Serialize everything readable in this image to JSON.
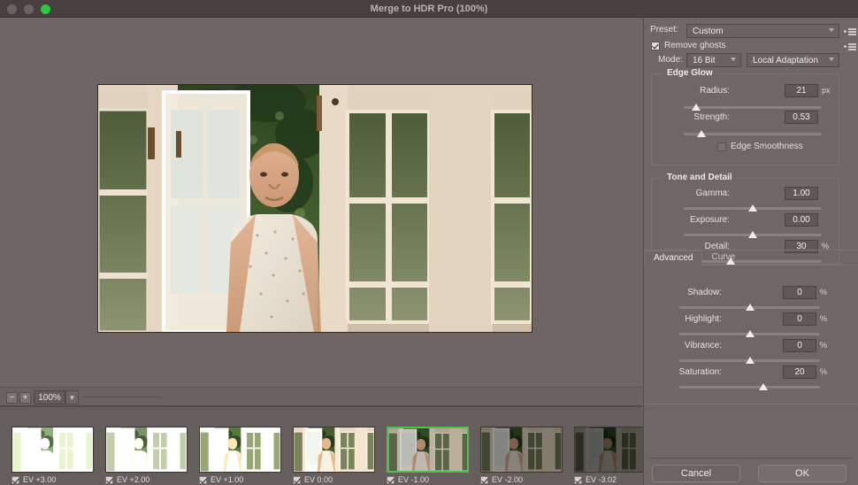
{
  "window": {
    "title": "Merge to HDR Pro (100%)",
    "traffic_lights": [
      "close-disabled",
      "minimize-disabled",
      "maximize-green"
    ]
  },
  "preview": {
    "zoom_out_icon": "minus-icon",
    "zoom_in_icon": "plus-icon",
    "zoom_value": "100%",
    "zoom_caret_icon": "chevron-down-icon"
  },
  "filmstrip": {
    "thumbnails": [
      {
        "label": "EV +3.00",
        "checked": true,
        "selected": false,
        "brightness": 2.05
      },
      {
        "label": "EV +2.00",
        "checked": true,
        "selected": false,
        "brightness": 1.72
      },
      {
        "label": "EV +1.00",
        "checked": true,
        "selected": false,
        "brightness": 1.38
      },
      {
        "label": "EV 0.00",
        "checked": true,
        "selected": false,
        "brightness": 1.08
      },
      {
        "label": "EV -1.00",
        "checked": true,
        "selected": true,
        "brightness": 0.82
      },
      {
        "label": "EV -2.00",
        "checked": true,
        "selected": false,
        "brightness": 0.58
      },
      {
        "label": "EV -3.02",
        "checked": true,
        "selected": false,
        "brightness": 0.38
      }
    ]
  },
  "panel": {
    "preset": {
      "label": "Preset:",
      "value": "Custom",
      "menu_icon": "flyout-menu-icon"
    },
    "remove_ghosts": {
      "label": "Remove ghosts",
      "checked": true,
      "menu_icon": "flyout-menu-icon"
    },
    "mode": {
      "label": "Mode:",
      "bit_depth": "16 Bit",
      "method": "Local Adaptation"
    },
    "edge_glow": {
      "title": "Edge Glow",
      "radius": {
        "label": "Radius:",
        "value": "21",
        "unit": "px",
        "pos_pct": 9
      },
      "strength": {
        "label": "Strength:",
        "value": "0.53",
        "unit": "",
        "pos_pct": 13
      },
      "edge_smoothness": {
        "label": "Edge Smoothness",
        "checked": false
      }
    },
    "tone_and_detail": {
      "title": "Tone and Detail",
      "gamma": {
        "label": "Gamma:",
        "value": "1.00",
        "unit": "",
        "pos_pct": 50
      },
      "exposure": {
        "label": "Exposure:",
        "value": "0.00",
        "unit": "",
        "pos_pct": 50
      },
      "detail": {
        "label": "Detail:",
        "value": "30",
        "unit": "%",
        "pos_pct": 34
      }
    },
    "advanced": {
      "tabs": [
        {
          "label": "Advanced",
          "active": true
        },
        {
          "label": "Curve",
          "active": false
        }
      ],
      "shadow": {
        "label": "Shadow:",
        "value": "0",
        "unit": "%",
        "pos_pct": 50
      },
      "highlight": {
        "label": "Highlight:",
        "value": "0",
        "unit": "%",
        "pos_pct": 50
      },
      "vibrance": {
        "label": "Vibrance:",
        "value": "0",
        "unit": "%",
        "pos_pct": 50
      },
      "saturation": {
        "label": "Saturation:",
        "value": "20",
        "unit": "%",
        "pos_pct": 60
      }
    }
  },
  "footer": {
    "cancel": "Cancel",
    "ok": "OK"
  },
  "colors": {
    "selection_green": "#4fc04f",
    "panel_bg": "#6f6666",
    "titlebar_bg": "#493f40"
  }
}
